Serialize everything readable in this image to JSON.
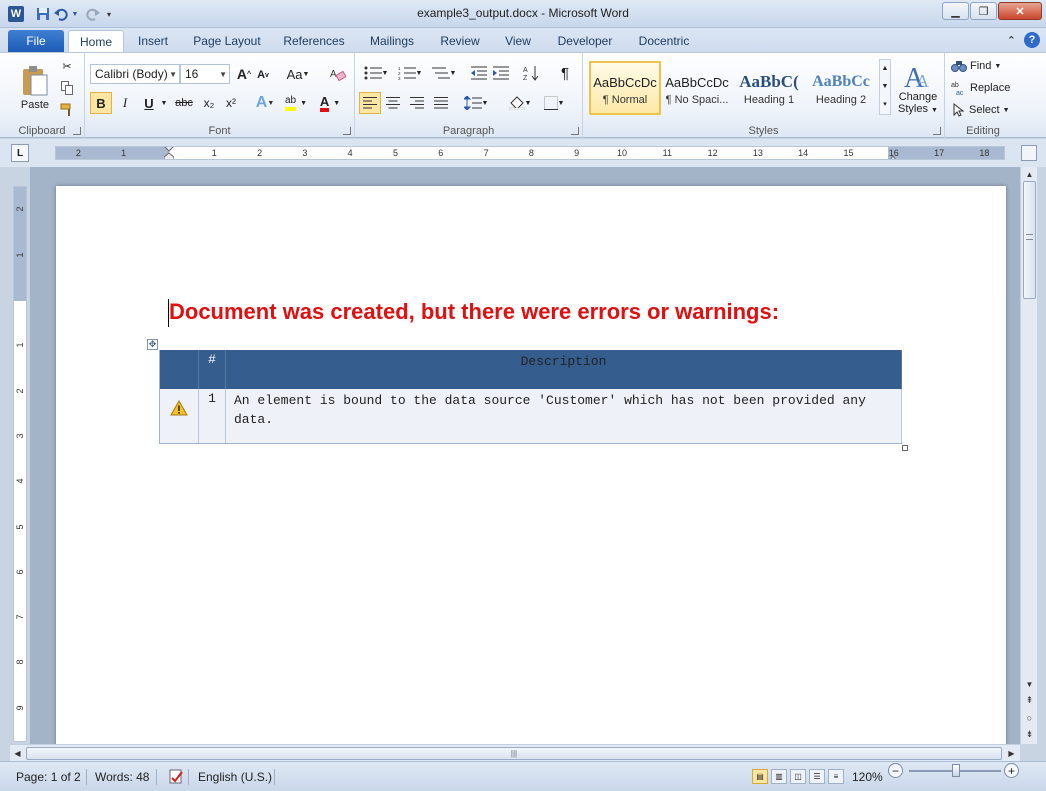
{
  "window": {
    "title": "example3_output.docx - Microsoft Word",
    "app_icon": "W"
  },
  "ribbon_tabs": {
    "file": "File",
    "items": [
      "Home",
      "Insert",
      "Page Layout",
      "References",
      "Mailings",
      "Review",
      "View",
      "Developer",
      "Docentric"
    ],
    "active": "Home"
  },
  "clipboard": {
    "paste": "Paste",
    "group_label": "Clipboard"
  },
  "font": {
    "name": "Calibri (Body)",
    "size": "16",
    "bold": "B",
    "italic": "I",
    "underline": "U",
    "strike": "abc",
    "subscript": "x₂",
    "superscript": "x²",
    "grow": "A",
    "shrink": "A",
    "change_case": "Aa",
    "font_color_letter": "A",
    "highlight_letter": "ab",
    "group_label": "Font"
  },
  "paragraph": {
    "pilcrow": "¶",
    "group_label": "Paragraph"
  },
  "styles": {
    "items": [
      {
        "sample": "AaBbCcDc",
        "name": "¶ Normal"
      },
      {
        "sample": "AaBbCcDc",
        "name": "¶ No Spaci..."
      },
      {
        "sample": "AaBbC(",
        "name": "Heading 1"
      },
      {
        "sample": "AaBbCc",
        "name": "Heading 2"
      }
    ],
    "selected": "¶ Normal",
    "change_styles_line1": "Change",
    "change_styles_line2": "Styles",
    "group_label": "Styles"
  },
  "editing": {
    "find": "Find",
    "replace": "Replace",
    "select": "Select",
    "group_label": "Editing"
  },
  "ruler": {
    "tab_selector": "L",
    "h_labels": [
      "2",
      "1",
      "1",
      "2",
      "3",
      "4",
      "5",
      "6",
      "7",
      "8",
      "9",
      "10",
      "11",
      "12",
      "13",
      "14",
      "15",
      "16",
      "17",
      "18"
    ],
    "v_labels": [
      "2",
      "1",
      "1",
      "2",
      "3",
      "4",
      "5",
      "6",
      "7",
      "8",
      "9"
    ]
  },
  "document": {
    "heading": "Document was created, but there were errors or warnings:",
    "table": {
      "headers": [
        "",
        "#",
        "Description"
      ],
      "rows": [
        {
          "icon": "warning-icon",
          "num": "1",
          "description": "An element is bound to the data source 'Customer' which has not been provided any data."
        }
      ]
    }
  },
  "status": {
    "page": "Page: 1 of 2",
    "words": "Words: 48",
    "language": "English (U.S.)",
    "zoom": "120%",
    "zoom_minus": "−",
    "zoom_plus": "+"
  },
  "colors": {
    "heading": "#e01010",
    "table_header": "#355d8e",
    "file_tab": "#1d5bb5"
  }
}
